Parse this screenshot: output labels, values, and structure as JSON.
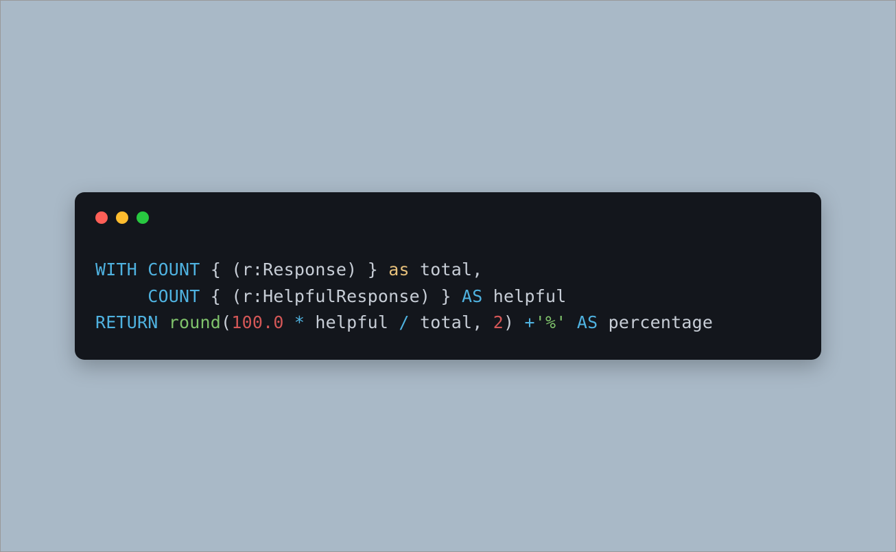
{
  "window": {
    "traffic_lights": {
      "red": "#ff5f57",
      "yellow": "#febc2e",
      "green": "#28c840"
    }
  },
  "code": {
    "line1_raw": "WITH COUNT { (r:Response) } as total,",
    "line2_raw": "     COUNT { (r:HelpfulResponse) } AS helpful",
    "line3_raw": "RETURN round(100.0 * helpful / total, 2) +'%' AS percentage",
    "tokens": {
      "WITH": "WITH",
      "COUNT": "COUNT",
      "lbrace": "{",
      "rbrace": "}",
      "lparen": "(",
      "rparen": ")",
      "r": "r",
      "colon": ":",
      "Response": "Response",
      "HelpfulResponse": "HelpfulResponse",
      "as_lower": "as",
      "AS": "AS",
      "total": "total",
      "comma": ",",
      "helpful": "helpful",
      "RETURN": "RETURN",
      "round": "round",
      "num100": "100.0",
      "star": "*",
      "slash": "/",
      "num2": "2",
      "plus": "+",
      "pct_str": "'%'",
      "percentage": "percentage",
      "space1": " ",
      "indent5": "     "
    }
  }
}
